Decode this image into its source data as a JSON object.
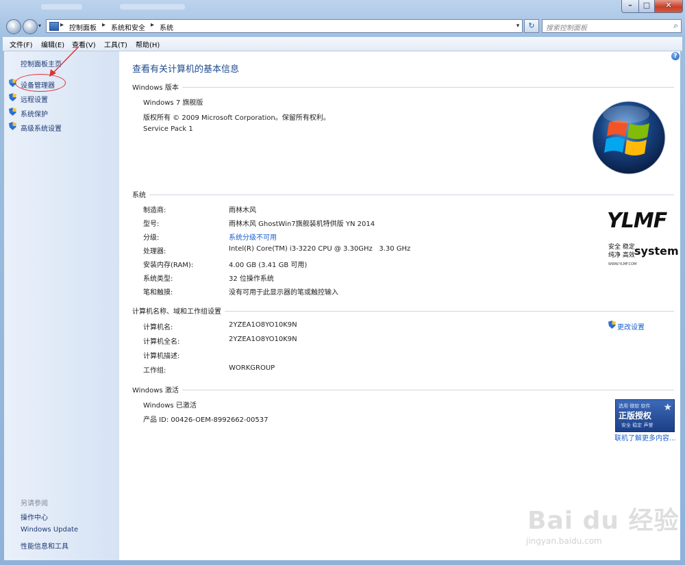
{
  "window": {
    "controls": {
      "minimize": "–",
      "maximize": "□",
      "close": "✕"
    }
  },
  "nav": {
    "back_icon": "back-arrow-icon",
    "forward_icon": "forward-arrow-icon",
    "breadcrumb": [
      "控制面板",
      "系统和安全",
      "系统"
    ],
    "separator": "▸",
    "search_placeholder": "搜索控制面板",
    "dropdown": "▾",
    "refresh": "↻"
  },
  "menubar": [
    "文件(F)",
    "编辑(E)",
    "查看(V)",
    "工具(T)",
    "帮助(H)"
  ],
  "sidebar": {
    "home": "控制面板主页",
    "tasks": [
      {
        "label": "设备管理器",
        "icon": "shield-icon"
      },
      {
        "label": "远程设置",
        "icon": "shield-icon"
      },
      {
        "label": "系统保护",
        "icon": "shield-icon"
      },
      {
        "label": "高级系统设置",
        "icon": "shield-icon"
      }
    ],
    "see_also_title": "另请参阅",
    "see_also": [
      "操作中心",
      "Windows Update",
      "性能信息和工具"
    ]
  },
  "main": {
    "title": "查看有关计算机的基本信息",
    "edition": {
      "heading": "Windows 版本",
      "name": "Windows 7 旗舰版",
      "copyright": "版权所有 © 2009 Microsoft Corporation。保留所有权利。",
      "service_pack": "Service Pack 1"
    },
    "system": {
      "heading": "系统",
      "rows": [
        {
          "label": "制造商:",
          "value": "雨林木风"
        },
        {
          "label": "型号:",
          "value": "雨林木风 GhostWin7旗舰装机特供版 YN 2014"
        },
        {
          "label": "分级:",
          "value": "系统分级不可用"
        },
        {
          "label": "处理器:",
          "value": "Intel(R) Core(TM) i3-3220 CPU @ 3.30GHz   3.30 GHz"
        },
        {
          "label": "安装内存(RAM):",
          "value": "4.00 GB (3.41 GB 可用)"
        },
        {
          "label": "系统类型:",
          "value": "32 位操作系统"
        },
        {
          "label": "笔和触摸:",
          "value": "没有可用于此显示器的笔或触控输入"
        }
      ]
    },
    "computer": {
      "heading": "计算机名称、域和工作组设置",
      "change_settings": "更改设置",
      "rows": [
        {
          "label": "计算机名:",
          "value": "2YZEA1O8YO10K9N"
        },
        {
          "label": "计算机全名:",
          "value": "2YZEA1O8YO10K9N"
        },
        {
          "label": "计算机描述:",
          "value": ""
        },
        {
          "label": "工作组:",
          "value": "WORKGROUP"
        }
      ]
    },
    "activation": {
      "heading": "Windows 激活",
      "status": "Windows 已激活",
      "product_id": "产品 ID: 00426-OEM-8992662-00537",
      "genuine_top": "选用 微软 软件",
      "genuine_main": "正版授权",
      "genuine_bottom": "安全 稳定 声誉",
      "learn_more": "联机了解更多内容..."
    },
    "oem_logo": {
      "brand": "YLMF",
      "line1": "安全 稳定",
      "line2": "纯净 高效",
      "word": "system",
      "url": "WWW.YLMF.COM"
    },
    "help": "?"
  },
  "watermark": {
    "brand": "Bai du 经验",
    "url": "jingyan.baidu.com"
  },
  "colors": {
    "link": "#1a5fcc",
    "title": "#1c4a8e",
    "annotation": "#e03030"
  }
}
